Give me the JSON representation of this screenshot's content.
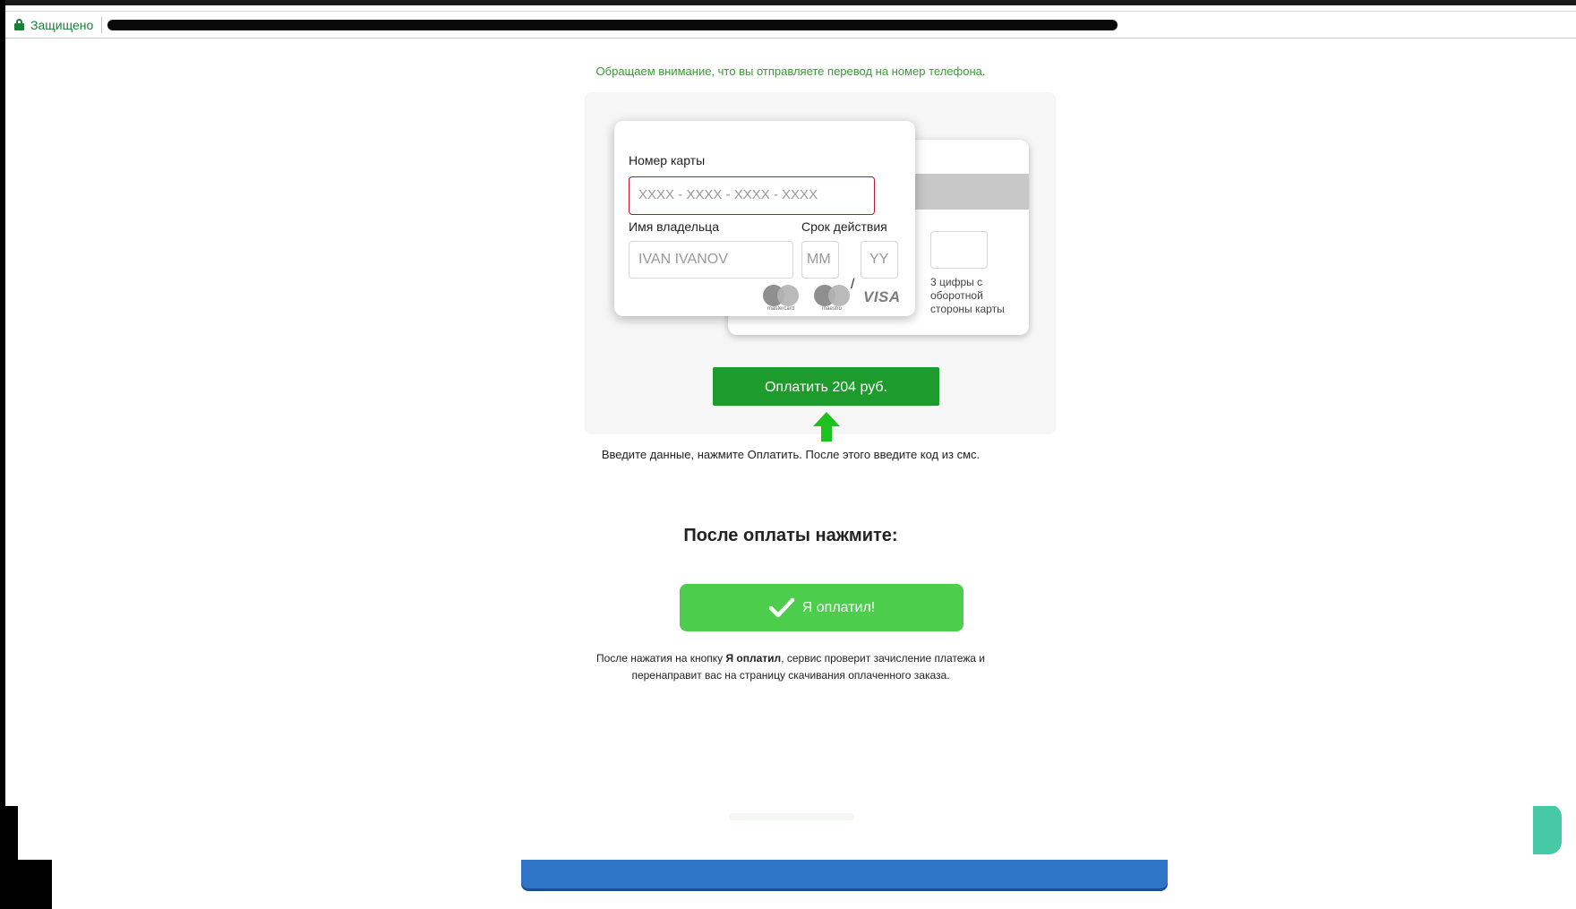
{
  "browser": {
    "secure_label": "Защищено"
  },
  "notice": "Обращаем внимание, что вы отправляете перевод на номер телефона.",
  "card_form": {
    "card_number_label": "Номер карты",
    "card_number_placeholder": "XXXX - XXXX - XXXX - XXXX",
    "holder_label": "Имя владельца",
    "holder_placeholder": "IVAN IVANOV",
    "expiry_label": "Срок действия",
    "month_placeholder": "MM",
    "year_placeholder": "YY",
    "expiry_separator": "/",
    "cvv_hint": "3 цифры с оборотной стороны карты",
    "logos": {
      "mastercard": "mastercard",
      "maestro": "maestro",
      "visa": "VISA"
    }
  },
  "pay_button_label": "Оплатить 204 руб.",
  "instructions": "Введите данные, нажмите Оплатить. После этого введите код из смс.",
  "after_payment": {
    "title": "После оплаты нажмите:",
    "paid_button_label": "Я оплатил!",
    "footnote_before": "После нажатия на кнопку ",
    "footnote_bold": "Я оплатил",
    "footnote_after": ", сервис проверит зачисление платежа и",
    "footnote_line2": "перенаправит вас на страницу скачивания оплаченного заказа."
  },
  "colors": {
    "secure_green": "#188038",
    "notice_green": "#3a9a34",
    "pay_button": "#1d9b2c",
    "paid_button": "#4cce4c",
    "card_number_border": "#c8102e",
    "arrow": "#1ec21e"
  }
}
